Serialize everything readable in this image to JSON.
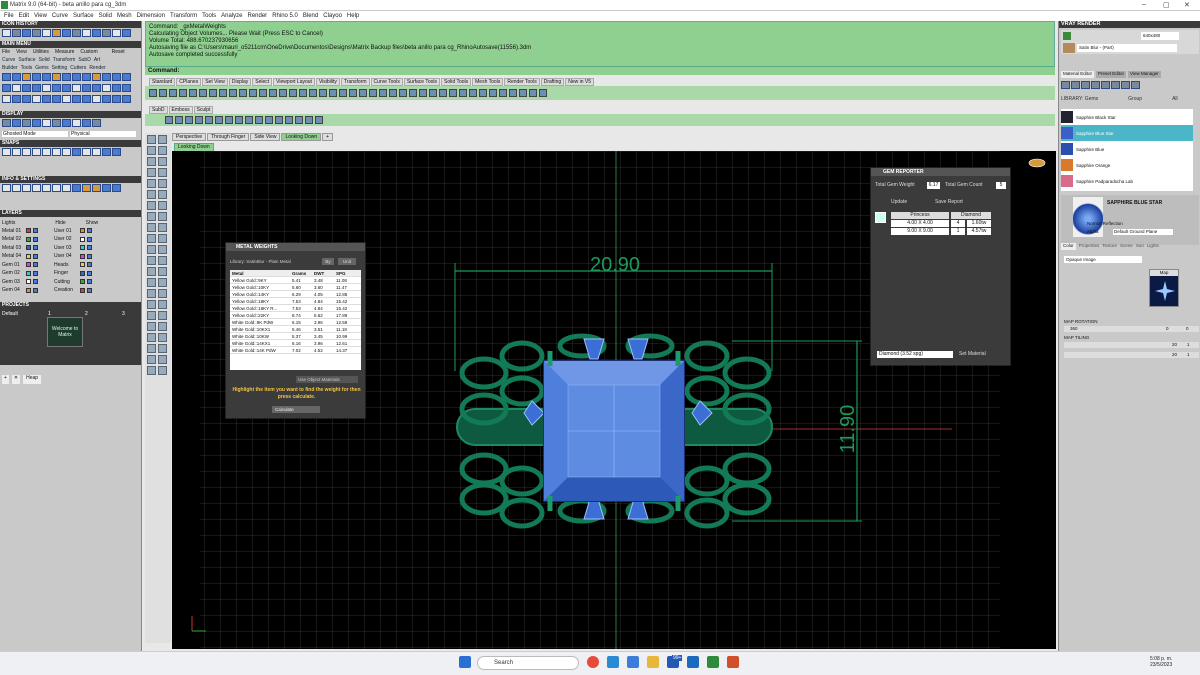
{
  "window": {
    "title": "Matrix 9.0 (64-bit) - beta anillo para cg_3dm"
  },
  "menu": [
    "File",
    "Edit",
    "View",
    "Curve",
    "Surface",
    "Solid",
    "Mesh",
    "Dimension",
    "Transform",
    "Tools",
    "Analyze",
    "Render",
    "Rhino 5.0",
    "Blend",
    "Clayoo",
    "Help"
  ],
  "left": {
    "icon_history": "ICON HISTORY",
    "main_menu": "MAIN MENU",
    "main_menu_items": [
      "File",
      "View",
      "Utilities",
      "Measure",
      "Custom",
      "Reset"
    ],
    "main_menu_row2": [
      "Curve",
      "Surface",
      "Solid",
      "Transform",
      "SubD",
      "Art"
    ],
    "main_menu_row3": [
      "Builder",
      "Tools",
      "Gems",
      "Setting",
      "Cutters",
      "Render"
    ],
    "display": "DISPLAY",
    "display_mode": "Ghosted Mode",
    "display_mode2": "Physical",
    "snaps": "SNAPS",
    "info": "INFO & SETTINGS",
    "layers": "LAYERS",
    "layers_top": [
      "Lights",
      "Hide",
      "Show"
    ],
    "layer_left": [
      "Metal 01",
      "Metal 02",
      "Metal 03",
      "Metal 04",
      "Gem 01",
      "Gem 02",
      "Gem 03",
      "Gem 04"
    ],
    "layer_right": [
      "User 01",
      "User 02",
      "User 03",
      "User 04",
      "Heads",
      "Finger",
      "Cutting",
      "Creation"
    ],
    "projects": "PROJECTS",
    "project_default": "Default",
    "thumb_text": "Welcome to Matrix",
    "thumb_nums": [
      "1",
      "2",
      "3"
    ],
    "heap": "Heap"
  },
  "command": {
    "lines": [
      "Command: _gxMetalWeights",
      "Calculating Object Volumes... Please Wait (Press ESC to Cancel)",
      "Volume Total: 488.670237930656",
      "Autosaving file as C:\\Users\\mauri_o5211cm\\OneDrive\\Documentos\\Designs\\Matrix Backup files\\beta anillo para cg_RhinoAutosave(11556).3dm",
      "Autosave completed successfully"
    ],
    "prompt": "Command:"
  },
  "toolbar_tabs": [
    "Standard",
    "CPlanes",
    "Set View",
    "Display",
    "Select",
    "Viewport Layout",
    "Visibility",
    "Transform",
    "Curve Tools",
    "Surface Tools",
    "Solid Tools",
    "Mesh Tools",
    "Render Tools",
    "Drafting",
    "New in V5"
  ],
  "sub_tabs": [
    "SubD",
    "Emboss",
    "Sculpt"
  ],
  "viewport_tabs": [
    "Perspective",
    "Through Finger",
    "Side View",
    "Looking Down",
    "+"
  ],
  "viewport_label": "Looking Down",
  "dims": {
    "width": "20.90",
    "height": "11.90"
  },
  "metal_weights": {
    "title": "METAL WEIGHTS",
    "library": "Library: SatinBlur - Plain Metal",
    "btn1": "By",
    "btn2": "Unit",
    "headers": [
      "Metal",
      "Grams",
      "DWT",
      "SPG"
    ],
    "rows": [
      [
        "Yellow Gold::9KY",
        "5.41",
        "3.48",
        "11.08"
      ],
      [
        "Yellow Gold::10KY",
        "5.60",
        "3.60",
        "11.47"
      ],
      [
        "Yellow Gold::14KY",
        "6.29",
        "4.05",
        "12.88"
      ],
      [
        "Yellow Gold::18KY",
        "7.53",
        "4.84",
        "15.42"
      ],
      [
        "Yellow Gold::18KY R...",
        "7.53",
        "4.84",
        "15.42"
      ],
      [
        "Yellow Gold::22KY",
        "8.74",
        "5.62",
        "17.89"
      ],
      [
        "White Gold::9K PdW",
        "6.15",
        "3.96",
        "12.59"
      ],
      [
        "White Gold::10KX1",
        "5.46",
        "3.51",
        "11.18"
      ],
      [
        "White Gold::10KW",
        "5.37",
        "3.45",
        "10.99"
      ],
      [
        "White Gold::14KX1",
        "6.16",
        "3.96",
        "12.61"
      ],
      [
        "White Gold::14K PdW",
        "7.02",
        "4.52",
        "14.37"
      ]
    ],
    "object_materials": "Use Object Materials",
    "hint": "Highlight the item you want to find the weight for then press calculate.",
    "calc": "Calculate"
  },
  "gem_reporter": {
    "title": "GEM REPORTER",
    "total_weight_label": "Total Gem Weight",
    "total_weight": "6.17",
    "total_count_label": "Total Gem Count",
    "total_count": "5",
    "update": "Update",
    "save": "Save Report",
    "headers": [
      "Princess",
      "Diamond"
    ],
    "rows": [
      [
        "4.00 X 4.00",
        "4",
        "1.60tw"
      ],
      [
        "9.00 X 9.00",
        "1",
        "4.57tw"
      ]
    ],
    "material": "Diamond (3.52 spg)",
    "set_material": "Set Material"
  },
  "right": {
    "vray": "VRAY RENDER",
    "res": "640x480",
    "mat_top": "Satin Blur - (Part)",
    "tabs": [
      "Material Editor",
      "Preset Editor",
      "View Manager"
    ],
    "lib": "LIBRARY: Gems",
    "group": "Group",
    "all": "All",
    "materials": [
      "Sapphire Black Star",
      "Sapphire Blue Star",
      "Sapphire Blue",
      "Sapphire Orange",
      "Sapphire Padparadscha Lab"
    ],
    "selected": "SAPPHIRE BLUE STAR",
    "props": [
      "Normal Reflection",
      "Alpha",
      "Default Ground Plane"
    ],
    "subtabs": [
      "Color",
      "Properties",
      "Texture",
      "Scene",
      "Sun",
      "Lights"
    ],
    "opaque": "Opaque Image",
    "map": "Map",
    "map_rotation": "MAP ROTATION",
    "map_tiling": "MAP TILING",
    "rot_vals": [
      "360",
      "0",
      "0"
    ],
    "tile_vals": [
      "20",
      "1",
      "20",
      "1"
    ]
  },
  "taskbar": {
    "search": "Search",
    "time": "5:08 p. m.",
    "date": "23/5/2023",
    "badge": "99+"
  }
}
